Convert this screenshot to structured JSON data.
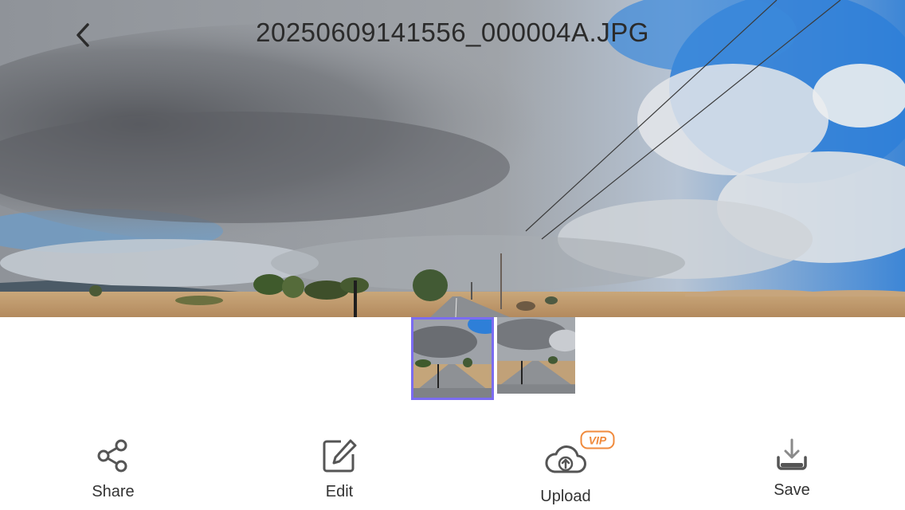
{
  "header": {
    "title": "20250609141556_000004A.JPG",
    "back_icon": "chevron-left-icon"
  },
  "thumbnails": {
    "items": [
      {
        "id": "thumb-1",
        "selected": true
      },
      {
        "id": "thumb-2",
        "selected": false
      }
    ],
    "selected_border_color": "#7b6cf0"
  },
  "toolbar": {
    "share_label": "Share",
    "edit_label": "Edit",
    "upload_label": "Upload",
    "save_label": "Save",
    "vip_badge": "VIP",
    "vip_color": "#f08a3c",
    "icon_color": "#555555"
  }
}
